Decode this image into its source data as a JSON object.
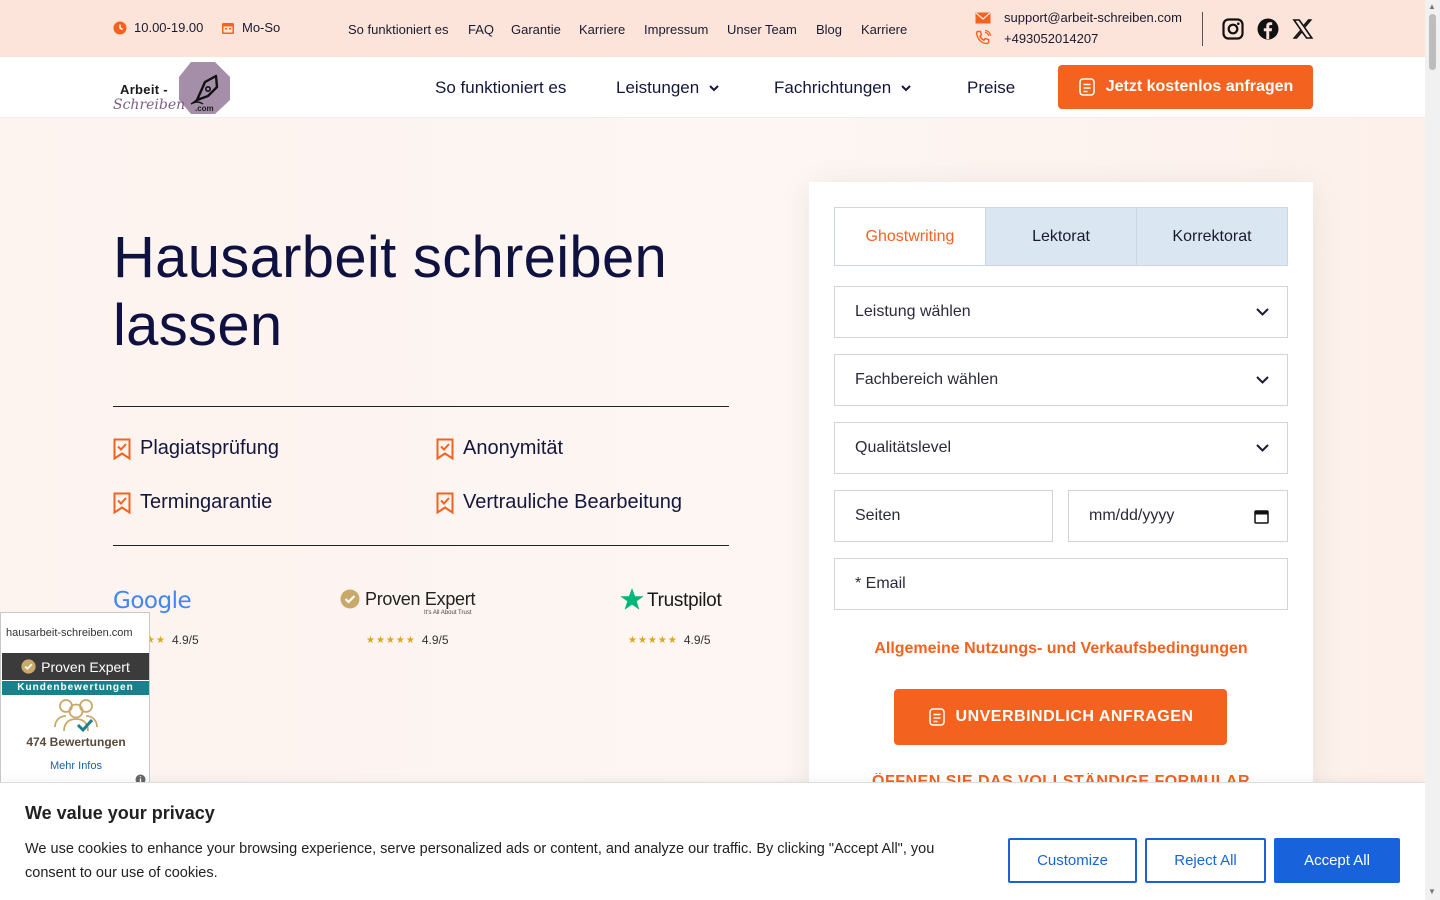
{
  "topbar": {
    "hours": "10.00-19.00",
    "days": "Mo-So",
    "links": [
      "So funktioniert es",
      "FAQ",
      "Garantie",
      "Karriere",
      "Impressum",
      "Unser Team",
      "Blog",
      "Karriere"
    ],
    "email": "support@arbeit-schreiben.com",
    "phone": "+493052014207"
  },
  "logo": {
    "line1": "Arbeit -",
    "line2": "Schreiben",
    "suffix": ".com"
  },
  "nav": {
    "links": [
      "So funktioniert es",
      "Leistungen",
      "Fachrichtungen",
      "Preise"
    ],
    "cta": "Jetzt kostenlos anfragen"
  },
  "hero": {
    "title": "Hausarbeit schreiben lassen",
    "features": [
      "Plagiatsprüfung",
      "Anonymität",
      "Termingarantie",
      "Vertrauliche Bearbeitung"
    ],
    "ratings": [
      {
        "brand": "Google",
        "score": "4.9/5"
      },
      {
        "brand": "Proven Expert",
        "tagline": "It's All About Trust",
        "score": "4.9/5"
      },
      {
        "brand": "Trustpilot",
        "score": "4.9/5"
      }
    ]
  },
  "form": {
    "tabs": [
      "Ghostwriting",
      "Lektorat",
      "Korrektorat"
    ],
    "active_tab": 0,
    "selects": [
      "Leistung wählen",
      "Fachbereich wählen",
      "Qualitätslevel"
    ],
    "pages_placeholder": "Seiten",
    "date_placeholder": "mm/dd/yyyy",
    "email_placeholder": "* Email",
    "terms": "Allgemeine Nutzungs- und Verkaufsbedingungen",
    "submit": "UNVERBINDLICH ANFRAGEN",
    "open_full": "ÖFFNEN SIE DAS VOLLSTÄNDIGE FORMULAR"
  },
  "widget": {
    "domain": "hausarbeit-schreiben.com",
    "brand": "Proven Expert",
    "strip": "Kundenbewertungen",
    "count": "474 Bewertungen",
    "more": "Mehr Infos"
  },
  "cookie": {
    "title": "We value your privacy",
    "text": "We use cookies to enhance your browsing experience, serve personalized ads or content, and analyze our traffic. By clicking \"Accept All\", you consent to our use of cookies.",
    "customize": "Customize",
    "reject": "Reject All",
    "accept": "Accept All"
  },
  "colors": {
    "accent": "#f4621f",
    "navy": "#14163b",
    "cookie_blue": "#1863dc"
  }
}
